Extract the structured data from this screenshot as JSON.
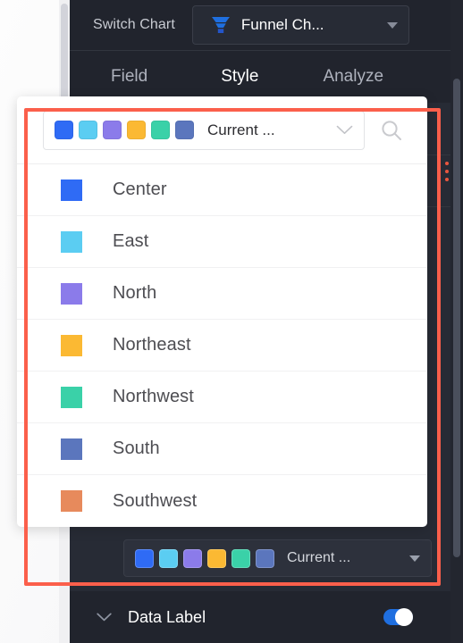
{
  "panel": {
    "switch_chart_label": "Switch Chart",
    "chart_type_value": "Funnel Ch...",
    "chart_type_icon": "funnel-icon",
    "dropdown_icon": "chevron-down-icon",
    "tabs": [
      {
        "label": "Field",
        "active": false
      },
      {
        "label": "Style",
        "active": true
      },
      {
        "label": "Analyze",
        "active": false
      }
    ]
  },
  "color_popup": {
    "combo_value": "Current ...",
    "combo_chevron_icon": "chevron-down-icon",
    "search_icon": "search-icon",
    "swatches": [
      "#2f6bf5",
      "#5bcdf2",
      "#8b7bea",
      "#fbb933",
      "#3ad1a8",
      "#5b76bd"
    ],
    "options": [
      {
        "label": "Center",
        "color": "#2f6bf5"
      },
      {
        "label": "East",
        "color": "#5bcdf2"
      },
      {
        "label": "North",
        "color": "#8b7bea"
      },
      {
        "label": "Northeast",
        "color": "#fbb933"
      },
      {
        "label": "Northwest",
        "color": "#3ad1a8"
      },
      {
        "label": "South",
        "color": "#5b76bd"
      },
      {
        "label": "Southwest",
        "color": "#e78a5c"
      }
    ]
  },
  "bottom_select": {
    "value": "Current ...",
    "chevron_icon": "chevron-down-icon",
    "swatches": [
      "#2f6bf5",
      "#5bcdf2",
      "#8b7bea",
      "#fbb933",
      "#3ad1a8",
      "#5b76bd"
    ]
  },
  "data_label": {
    "label": "Data Label",
    "expand_icon": "chevron-down-icon",
    "toggle_on": true,
    "toggle_color": "#1f6fe0"
  },
  "highlight": {
    "color": "#fb5f4b"
  }
}
